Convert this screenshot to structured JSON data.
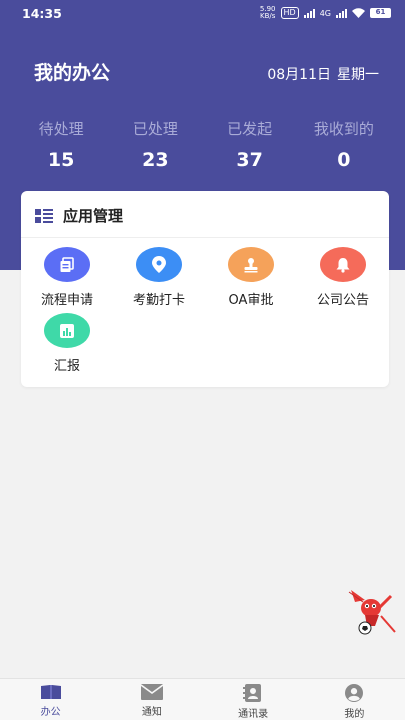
{
  "status_bar": {
    "time": "14:35",
    "speed_value": "5.90",
    "speed_unit": "KB/s",
    "hd": "HD",
    "network": "4G",
    "battery": "61"
  },
  "header": {
    "title": "我的办公",
    "date": "08月11日",
    "weekday": "星期一"
  },
  "stats": [
    {
      "label": "待处理",
      "value": "15"
    },
    {
      "label": "已处理",
      "value": "23"
    },
    {
      "label": "已发起",
      "value": "37"
    },
    {
      "label": "我收到的",
      "value": "0"
    }
  ],
  "app_section": {
    "title": "应用管理",
    "apps": [
      {
        "label": "流程申请",
        "icon": "document-icon",
        "color": "#5b6ef5"
      },
      {
        "label": "考勤打卡",
        "icon": "location-pin-icon",
        "color": "#3c8ef5"
      },
      {
        "label": "OA审批",
        "icon": "stamp-icon",
        "color": "#f5a25a"
      },
      {
        "label": "公司公告",
        "icon": "bell-icon",
        "color": "#f56b5a"
      },
      {
        "label": "汇报",
        "icon": "report-chart-icon",
        "color": "#3fd9a8"
      }
    ]
  },
  "tabbar": [
    {
      "label": "办公",
      "icon": "book-icon",
      "active": true
    },
    {
      "label": "通知",
      "icon": "envelope-icon",
      "active": false
    },
    {
      "label": "通讯录",
      "icon": "contacts-icon",
      "active": false
    },
    {
      "label": "我的",
      "icon": "user-icon",
      "active": false
    }
  ],
  "colors": {
    "primary": "#4a4c9c",
    "background": "#f2f2f2"
  }
}
